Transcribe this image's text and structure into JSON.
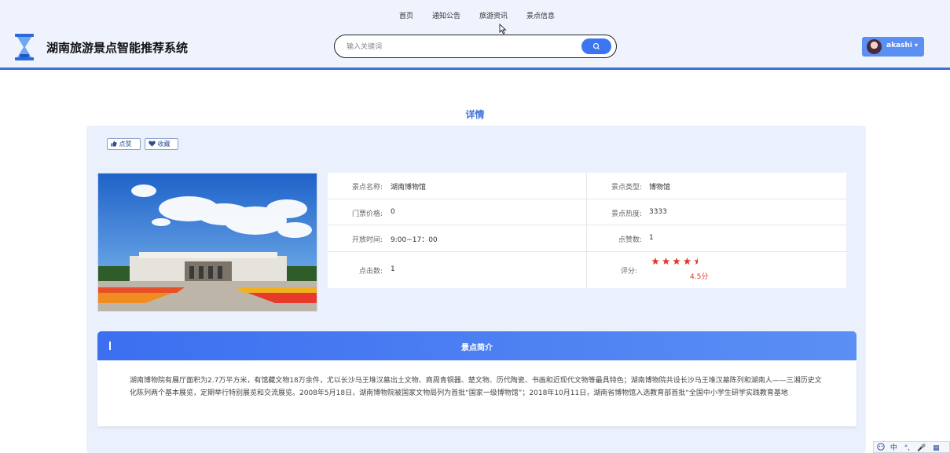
{
  "nav": {
    "items": [
      "首页",
      "通知公告",
      "旅游资讯",
      "景点信息"
    ]
  },
  "header": {
    "site_title": "湖南旅游景点智能推荐系统",
    "search_placeholder": "输入关键词",
    "user_name": "akashi",
    "caret": "▾"
  },
  "page": {
    "title": "详情",
    "like_label": "点赞",
    "favorite_label": "收藏"
  },
  "details": {
    "name_label": "景点名称:",
    "name_value": "湖南博物馆",
    "type_label": "景点类型:",
    "type_value": "博物馆",
    "price_label": "门票价格:",
    "price_value": "0",
    "heat_label": "景点热度:",
    "heat_value": "3333",
    "hours_label": "开放时间:",
    "hours_value": "9:00~17：00",
    "likes_label": "点赞数:",
    "likes_value": "1",
    "clicks_label": "点击数:",
    "clicks_value": "1",
    "rating_label": "评分:",
    "rating_score": "4.5分",
    "rating_stars": 4.5
  },
  "intro": {
    "title": "景点简介",
    "text": "湖南博物院有展厅面积为2.7万平方米，有馆藏文物18万余件，尤以长沙马王堆汉墓出土文物、商周青铜器、楚文物、历代陶瓷、书画和近现代文物等最具特色；湖南博物院共设长沙马王堆汉墓陈列和湖南人——三湘历史文化陈列两个基本展览，定期举行特别展览和交流展览。2008年5月18日，湖南博物院被国家文物局列为首批“国家一级博物馆”；2018年10月11日，湖南省博物馆入选教育部首批“全国中小学生研学实践教育基地"
  },
  "toolbar": {
    "items": [
      "中",
      "°,",
      "🎤",
      "▦"
    ]
  },
  "colors": {
    "accent": "#3f6fd8",
    "button": "#3b76f0",
    "card_bg": "#eaf1fd",
    "star": "#e03a2c"
  }
}
